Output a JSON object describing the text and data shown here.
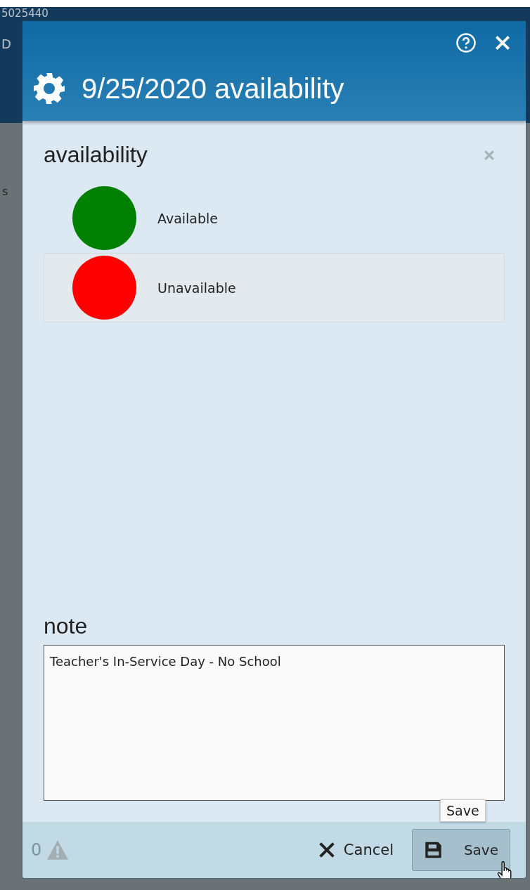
{
  "background": {
    "texts": [
      "5025440",
      "D",
      "s"
    ]
  },
  "dialog": {
    "title": "9/25/2020 availability",
    "availability": {
      "label": "availability",
      "options": [
        {
          "label": "Available",
          "color": "#008000",
          "selected": false
        },
        {
          "label": "Unavailable",
          "color": "#ff0000",
          "selected": true
        }
      ]
    },
    "note": {
      "label": "note",
      "value": "Teacher's In-Service Day - No School"
    },
    "footer": {
      "warning_count": "0",
      "cancel": "Cancel",
      "save": "Save",
      "tooltip": "Save"
    }
  }
}
